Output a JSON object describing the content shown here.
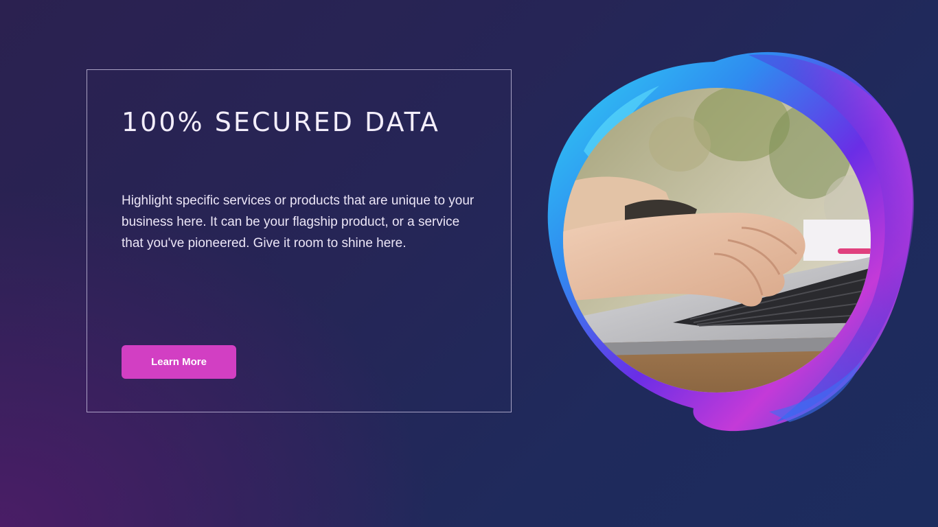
{
  "hero": {
    "title": "100% SECURED DATA",
    "description": "Highlight specific services or products that are unique to your business here. It can be your flagship product, or a service that you've pioneered. Give it room to shine here.",
    "button_label": "Learn More"
  },
  "colors": {
    "accent": "#d23fc3",
    "background_dark_purple": "#4a1d66",
    "background_navy": "#1c2c5e",
    "ring_blue": "#2f8cf0",
    "ring_purple": "#8a2be2",
    "ring_magenta": "#c43ad8"
  },
  "image": {
    "subject": "hands typing on a laptop keyboard"
  }
}
